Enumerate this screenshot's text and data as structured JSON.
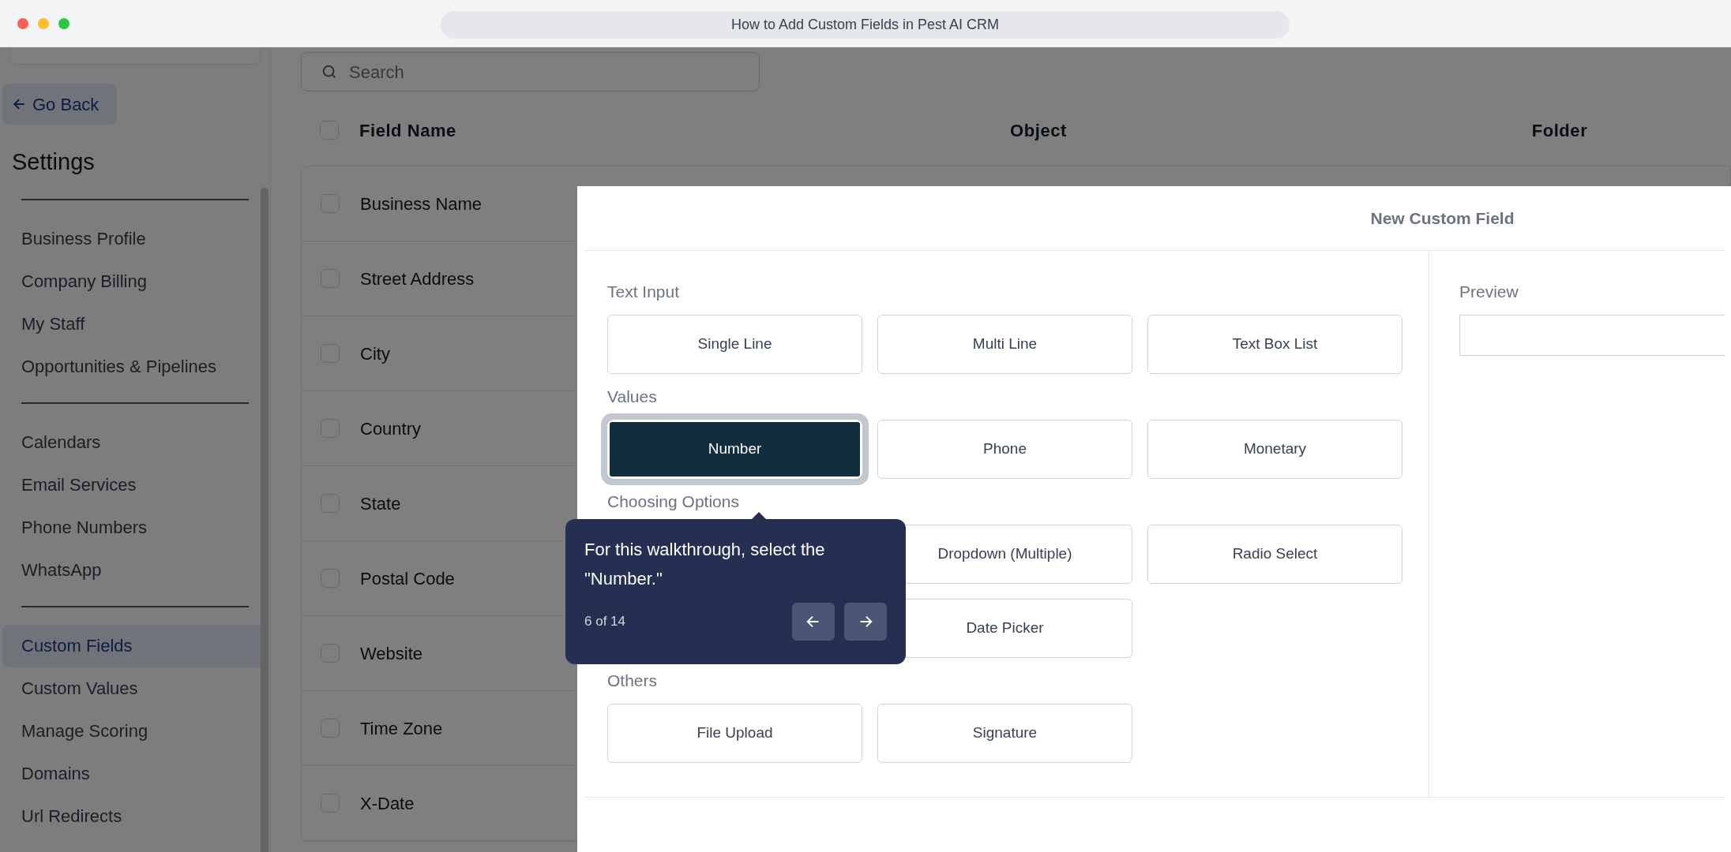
{
  "window": {
    "title": "How to Add Custom Fields in Pest AI CRM"
  },
  "sidebar": {
    "back_label": "Go Back",
    "title": "Settings",
    "groups": [
      [
        {
          "label": "Business Profile",
          "selected": false
        },
        {
          "label": "Company Billing",
          "selected": false
        },
        {
          "label": "My Staff",
          "selected": false
        },
        {
          "label": "Opportunities & Pipelines",
          "selected": false
        }
      ],
      [
        {
          "label": "Calendars",
          "selected": false
        },
        {
          "label": "Email Services",
          "selected": false
        },
        {
          "label": "Phone Numbers",
          "selected": false
        },
        {
          "label": "WhatsApp",
          "selected": false
        }
      ],
      [
        {
          "label": "Custom Fields",
          "selected": true
        },
        {
          "label": "Custom Values",
          "selected": false
        },
        {
          "label": "Manage Scoring",
          "selected": false
        },
        {
          "label": "Domains",
          "selected": false
        },
        {
          "label": "Url Redirects",
          "selected": false
        }
      ]
    ]
  },
  "search": {
    "placeholder": "Search"
  },
  "table": {
    "header_checked": false,
    "columns": [
      "Field Name",
      "Object",
      "Folder"
    ],
    "rows": [
      {
        "name": "Business Name",
        "checked": false
      },
      {
        "name": "Street Address",
        "checked": false
      },
      {
        "name": "City",
        "checked": false
      },
      {
        "name": "Country",
        "checked": false
      },
      {
        "name": "State",
        "checked": false
      },
      {
        "name": "Postal Code",
        "checked": false
      },
      {
        "name": "Website",
        "checked": false
      },
      {
        "name": "Time Zone",
        "checked": false
      },
      {
        "name": "X-Date",
        "checked": false
      }
    ]
  },
  "modal": {
    "title": "New Custom Field",
    "sections": [
      {
        "label": "Text Input",
        "fields": [
          {
            "label": "Single Line",
            "selected": false
          },
          {
            "label": "Multi Line",
            "selected": false
          },
          {
            "label": "Text Box List",
            "selected": false
          }
        ]
      },
      {
        "label": "Values",
        "fields": [
          {
            "label": "Number",
            "selected": true
          },
          {
            "label": "Phone",
            "selected": false
          },
          {
            "label": "Monetary",
            "selected": false
          }
        ]
      },
      {
        "label": "Choosing Options",
        "fields": [
          {
            "kind": "covered"
          },
          {
            "kind": "option",
            "label": "Dropdown (Multiple)",
            "selected": false
          },
          {
            "kind": "option",
            "label": "Radio Select",
            "selected": false
          },
          {
            "kind": "covered"
          },
          {
            "kind": "option",
            "label": "Date Picker",
            "selected": false
          }
        ]
      },
      {
        "label": "Others",
        "fields": [
          {
            "label": "File Upload",
            "selected": false
          },
          {
            "label": "Signature",
            "selected": false
          }
        ]
      }
    ],
    "preview_label": "Preview"
  },
  "tooltip": {
    "text": "For this walkthrough, select the \"Number.\"",
    "step": "6 of 14"
  }
}
